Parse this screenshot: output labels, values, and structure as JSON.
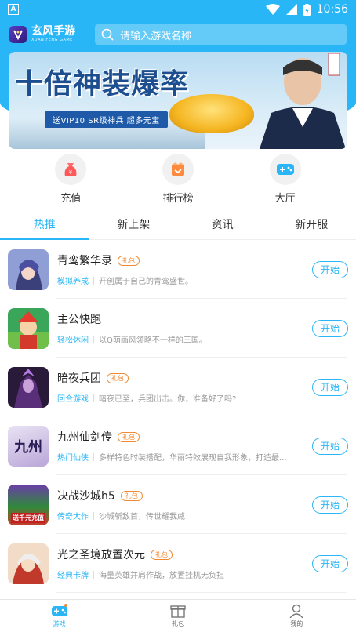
{
  "status_bar": {
    "time": "10:56",
    "left_badge": "A"
  },
  "header": {
    "logo_cn": "玄风手游",
    "logo_en": "XUAN FENG GAME",
    "search_placeholder": "请输入游戏名称"
  },
  "banner": {
    "headline": "十倍神装爆率",
    "subline": "送VIP10 SR级神兵 超多元宝"
  },
  "quick_nav": [
    {
      "label": "充值",
      "icon": "recharge-bag-icon"
    },
    {
      "label": "排行榜",
      "icon": "ranking-icon"
    },
    {
      "label": "大厅",
      "icon": "gamepad-icon"
    }
  ],
  "tabs": [
    {
      "label": "热推",
      "active": true
    },
    {
      "label": "新上架",
      "active": false
    },
    {
      "label": "资讯",
      "active": false
    },
    {
      "label": "新开服",
      "active": false
    }
  ],
  "games": [
    {
      "name": "青鸾繁华录",
      "badge": "礼包",
      "category": "模拟养成",
      "desc": "开创属于自己的青鸾盛世。",
      "button": "开始"
    },
    {
      "name": "主公快跑",
      "badge": "",
      "category": "轻松休闲",
      "desc": "以Q萌画风领略不一样的三国。",
      "button": "开始"
    },
    {
      "name": "暗夜兵团",
      "badge": "礼包",
      "category": "回合游戏",
      "desc": "暗夜已至，兵团出击。你，准备好了吗?",
      "button": "开始"
    },
    {
      "name": "九州仙剑传",
      "badge": "礼包",
      "category": "热门仙侠",
      "desc": "多样特色时装搭配，华丽特效展现自我形象，打造最...",
      "button": "开始"
    },
    {
      "name": "决战沙城h5",
      "badge": "礼包",
      "category": "传奇大作",
      "desc": "沙城斩敌首，传世耀我威",
      "button": "开始"
    },
    {
      "name": "光之圣境放置次元",
      "badge": "礼包",
      "category": "经典卡牌",
      "desc": "海量英雄并肩作战，放置挂机无负担",
      "button": "开始"
    }
  ],
  "thumb_texts": {
    "jiuzhou": "九州",
    "juezhan": "送千元充值"
  },
  "bottom_nav": [
    {
      "label": "游戏",
      "active": true
    },
    {
      "label": "礼包",
      "active": false
    },
    {
      "label": "我的",
      "active": false
    }
  ],
  "colors": {
    "accent": "#29b6f6",
    "badge": "#f08a32"
  }
}
